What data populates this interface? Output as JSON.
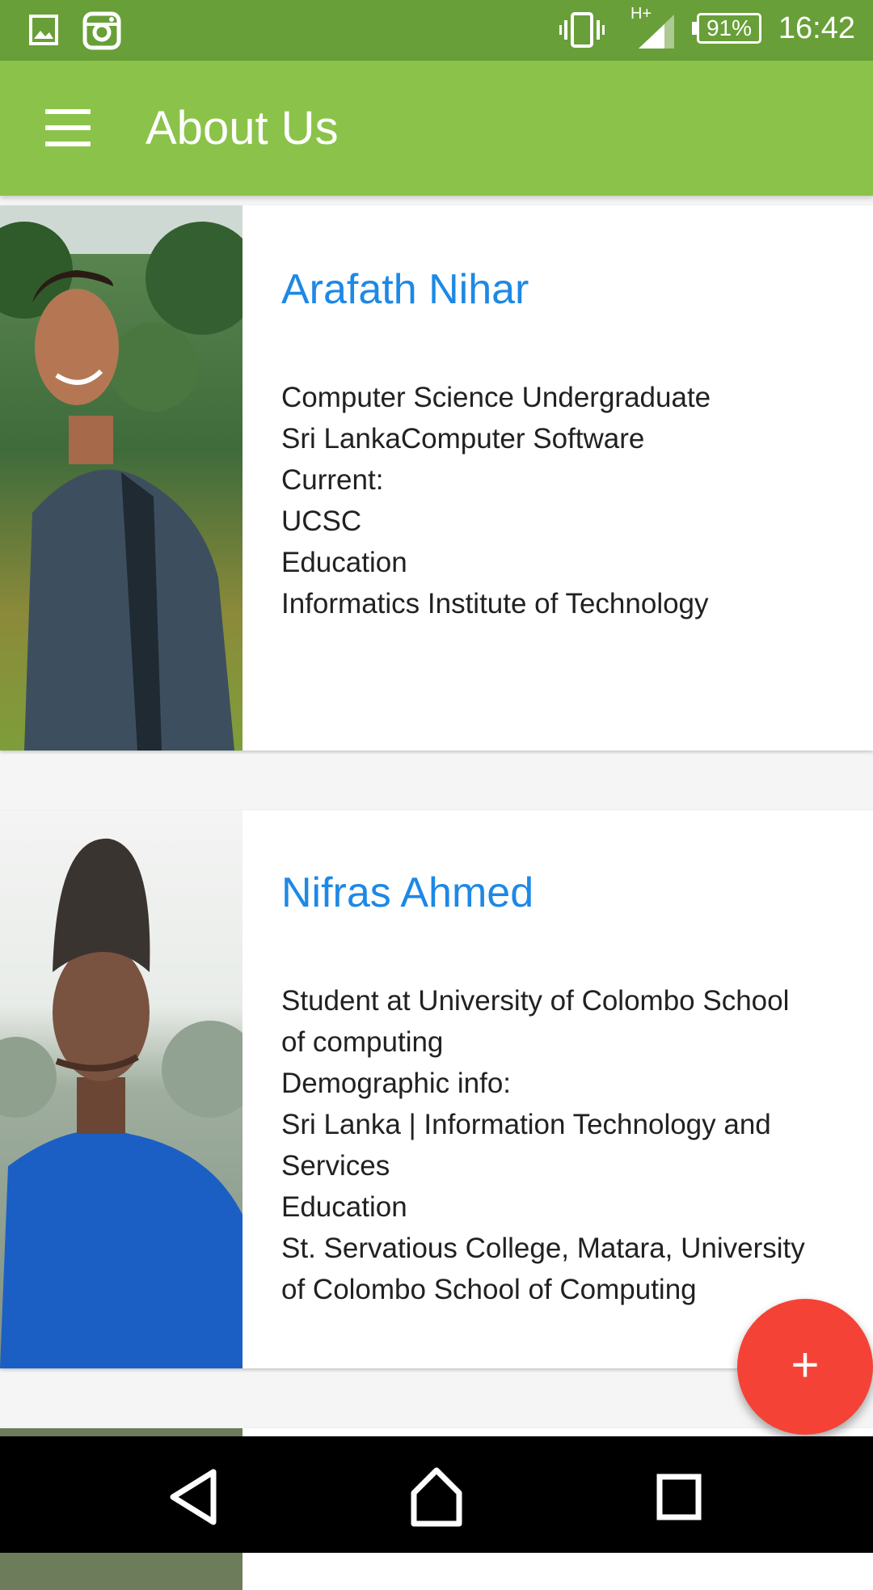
{
  "status_bar": {
    "time": "16:42",
    "battery": "91%",
    "network": "H+",
    "icons": [
      "gallery-icon",
      "instagram-icon",
      "vibrate-icon",
      "signal-icon",
      "battery-icon"
    ]
  },
  "app_bar": {
    "title": "About Us",
    "menu_icon": "hamburger-menu-icon"
  },
  "members": [
    {
      "name": "Arafath Nihar",
      "description": "Computer Science Undergraduate\nSri LankaComputer Software\nCurrent:\nUCSC\nEducation\nInformatics Institute of Technology"
    },
    {
      "name": "Nifras Ahmed",
      "description": "Student at University of Colombo School\nof computing\nDemographic info:\nSri Lanka | Information Technology and\nServices\nEducation\nSt. Servatious College, Matara, University\nof Colombo School of Computing"
    }
  ],
  "fab": {
    "label": "+",
    "icon": "add-icon"
  },
  "nav_bar": {
    "icons": [
      "back-icon",
      "home-icon",
      "recents-icon"
    ]
  },
  "colors": {
    "status_bar": "#689f38",
    "app_bar": "#8bc34a",
    "name_text": "#1e88e5",
    "fab": "#f44336"
  }
}
